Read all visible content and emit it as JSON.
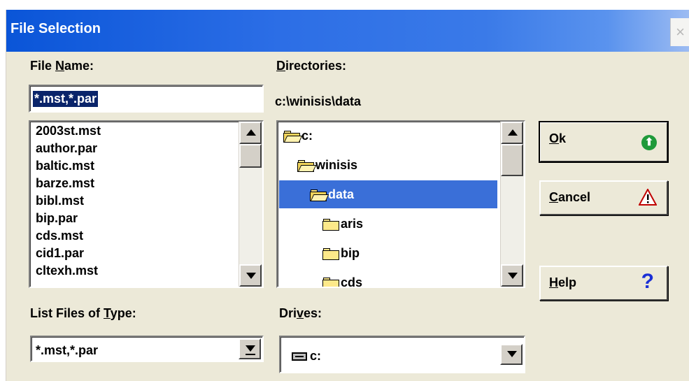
{
  "window": {
    "title": "File Selection",
    "close_glyph": "×"
  },
  "file_name": {
    "label_before": "File ",
    "label_mnemonic": "N",
    "label_after": "ame:",
    "value": "*.mst,*.par",
    "items": [
      "2003st.mst",
      "author.par",
      "baltic.mst",
      "barze.mst",
      "bibl.mst",
      "bip.par",
      "cds.mst",
      "cid1.par",
      "cltexh.mst"
    ]
  },
  "directories": {
    "label_mnemonic": "D",
    "label_after": "irectories:",
    "path": "c:\\winisis\\data",
    "items": [
      {
        "label": "c:",
        "icon": "folder-open-icon",
        "selected": false
      },
      {
        "label": "winisis",
        "icon": "folder-open-icon",
        "selected": false
      },
      {
        "label": "data",
        "icon": "folder-open-icon",
        "selected": true
      },
      {
        "label": "aris",
        "icon": "folder-closed-icon",
        "selected": false
      },
      {
        "label": "bip",
        "icon": "folder-closed-icon",
        "selected": false
      },
      {
        "label": "cds",
        "icon": "folder-closed-icon",
        "selected": false
      }
    ]
  },
  "buttons": {
    "ok": {
      "mnemonic": "O",
      "rest": "k",
      "icon": "ok-arrow-icon",
      "glyph": "⬆"
    },
    "cancel": {
      "mnemonic": "C",
      "rest": "ancel",
      "icon": "warning-icon"
    },
    "help": {
      "mnemonic": "H",
      "rest": "elp",
      "icon": "question-icon",
      "glyph": "?"
    }
  },
  "file_type": {
    "label_before": "List Files of ",
    "label_mnemonic": "T",
    "label_after": "ype:",
    "value": "*.mst,*.par"
  },
  "drives": {
    "label_before": "Dri",
    "label_mnemonic": "v",
    "label_after": "es:",
    "value": "c:",
    "icon": "drive-icon"
  },
  "colors": {
    "title_bar": "#0a55d8",
    "selection": "#3a6fd8",
    "dialog_bg": "#ece9d8"
  }
}
